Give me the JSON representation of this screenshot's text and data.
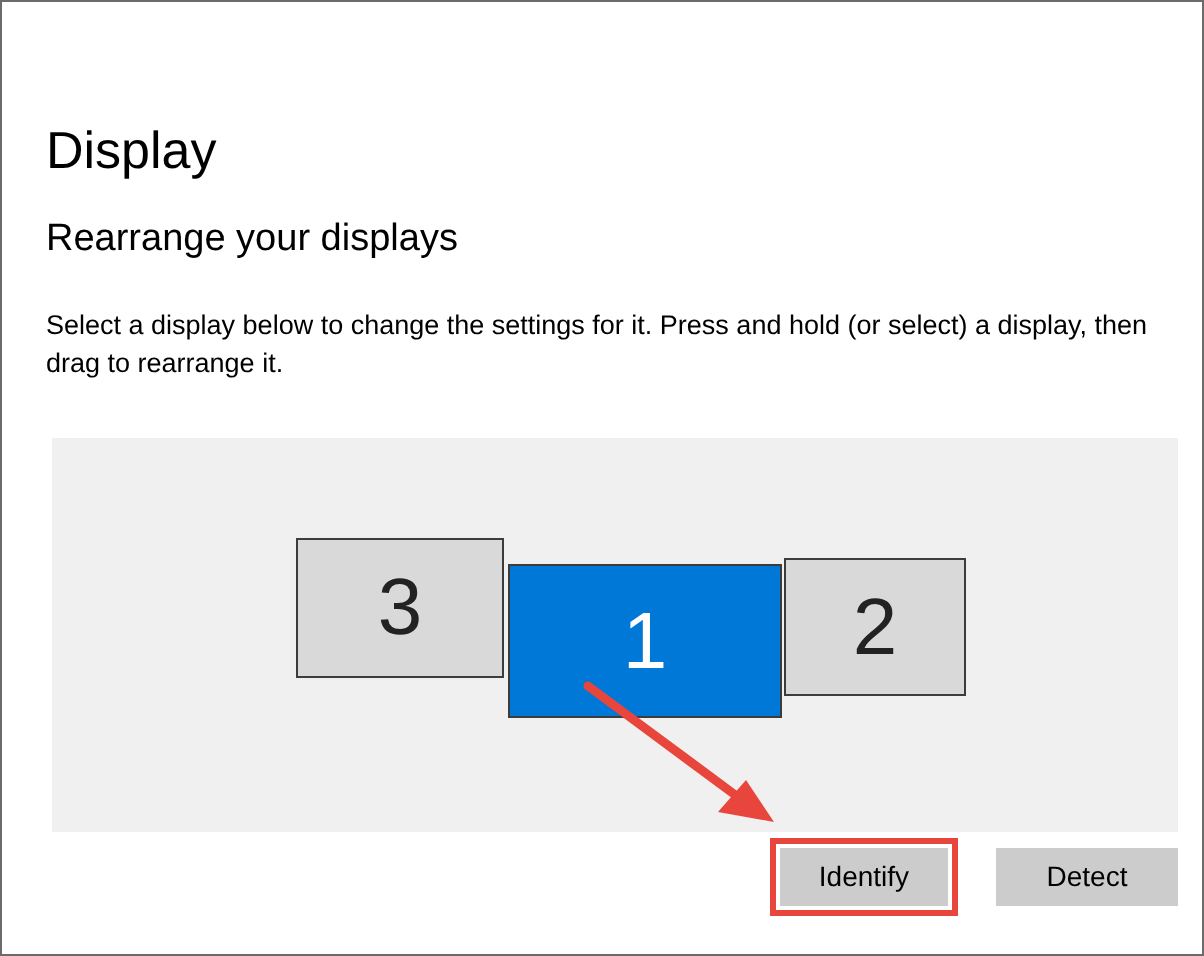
{
  "page": {
    "title": "Display",
    "subtitle": "Rearrange your displays",
    "description": "Select a display below to change the settings for it. Press and hold (or select) a display, then drag to rearrange it."
  },
  "displays": [
    {
      "label": "3",
      "selected": false
    },
    {
      "label": "1",
      "selected": true
    },
    {
      "label": "2",
      "selected": false
    }
  ],
  "buttons": [
    {
      "label": "Identify",
      "highlighted": true
    },
    {
      "label": "Detect",
      "highlighted": false
    }
  ]
}
